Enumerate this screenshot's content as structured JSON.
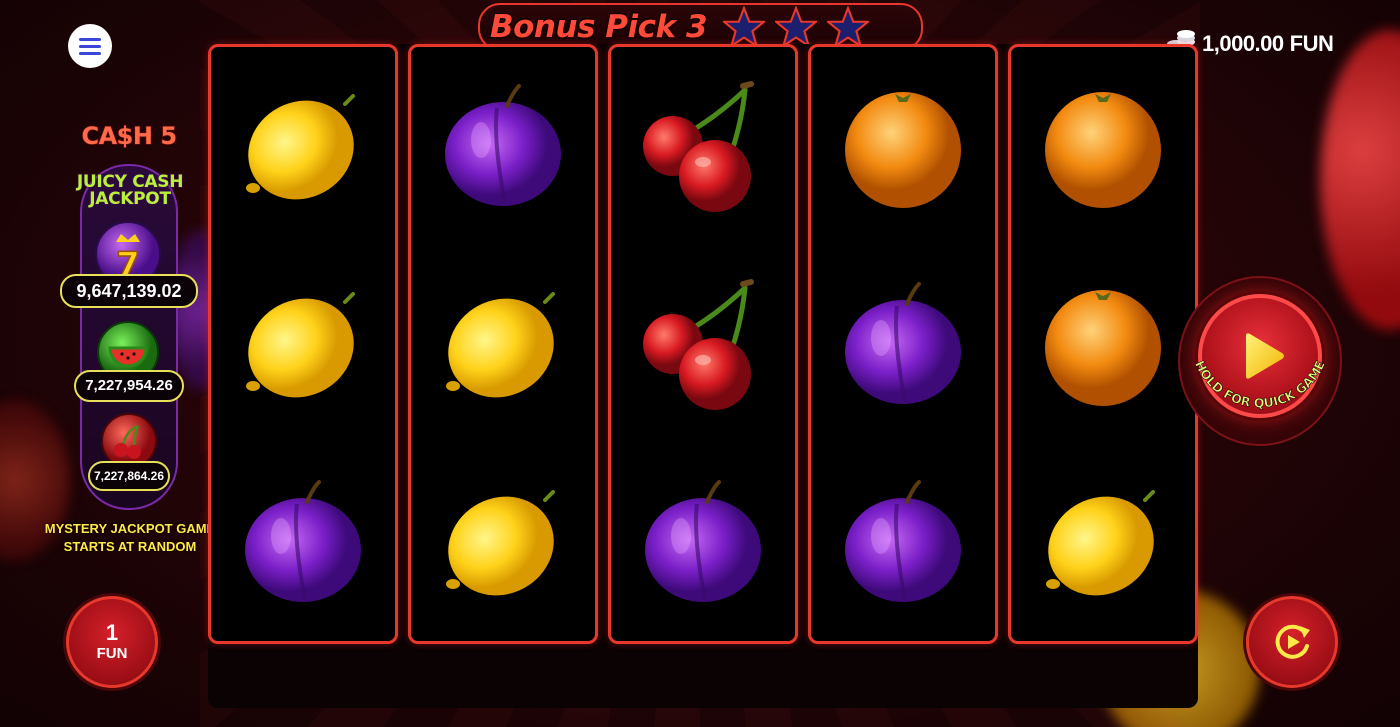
{
  "game": {
    "title": "Bonus Pick 3",
    "stars_filled": 3,
    "star_color": "#1c1f6e"
  },
  "balance": {
    "amount": "1,000.00",
    "currency": "FUN",
    "icon": "coin-stack-icon"
  },
  "menu": {
    "icon": "hamburger-menu-icon"
  },
  "jackpot_panel": {
    "brand": "CA$H 5",
    "heading_line1": "JUICY CASH",
    "heading_line2": "JACKPOT",
    "tiers": [
      {
        "icon": "seven-crown-icon",
        "amount": "9,647,139.02"
      },
      {
        "icon": "watermelon-icon",
        "amount": "7,227,954.26"
      },
      {
        "icon": "cherry-icon",
        "amount": "7,227,864.26"
      }
    ],
    "notice_line1": "MYSTERY JACKPOT GAME",
    "notice_line2": "STARTS AT RANDOM"
  },
  "reels": [
    [
      "lemon",
      "lemon",
      "plum"
    ],
    [
      "plum",
      "lemon",
      "lemon"
    ],
    [
      "cherry",
      "cherry",
      "plum"
    ],
    [
      "orange",
      "plum",
      "plum"
    ],
    [
      "orange",
      "orange",
      "lemon"
    ]
  ],
  "bet": {
    "value": "1",
    "unit": "FUN"
  },
  "spin": {
    "caption": "HOLD FOR QUICK GAME",
    "icon": "play-icon"
  },
  "autoplay": {
    "icon": "autoplay-icon"
  },
  "colors": {
    "reel_border": "#e8382c",
    "jackpot_text": "#b8f03a",
    "notice_text": "#ffe94a"
  }
}
